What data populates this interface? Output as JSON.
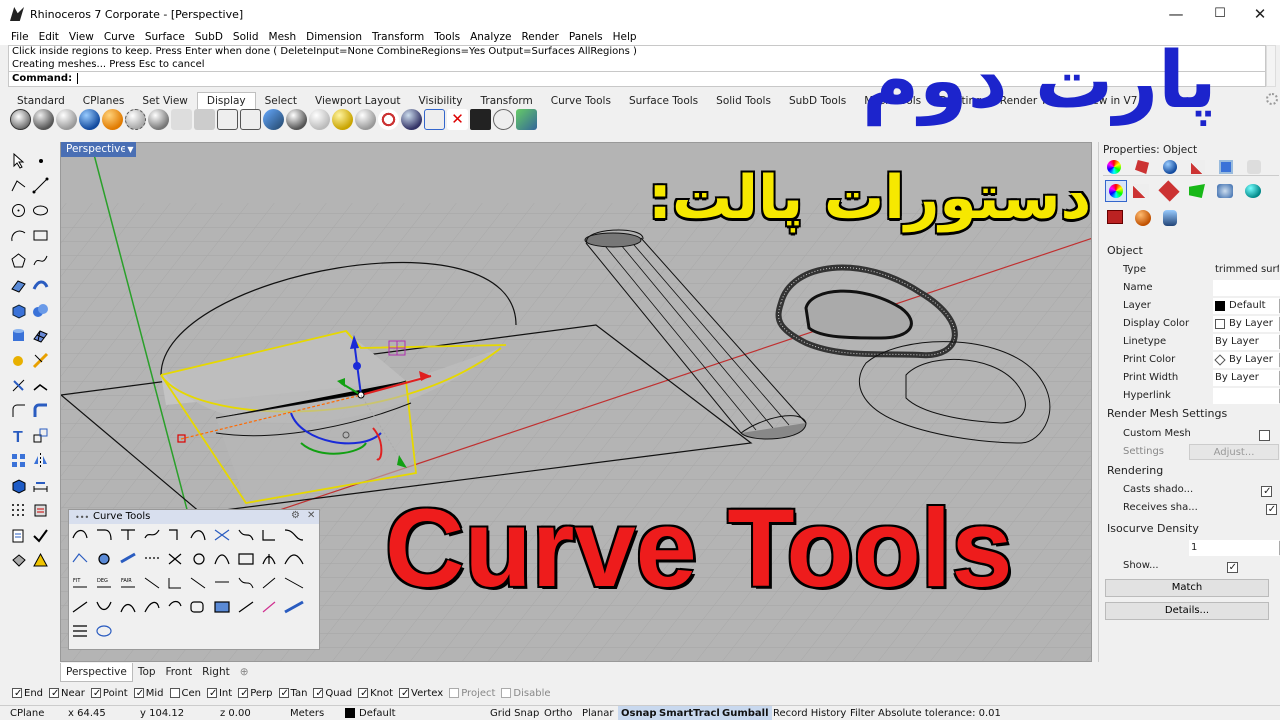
{
  "window": {
    "title": "Rhinoceros 7 Corporate - [Perspective]"
  },
  "menu": [
    "File",
    "Edit",
    "View",
    "Curve",
    "Surface",
    "SubD",
    "Solid",
    "Mesh",
    "Dimension",
    "Transform",
    "Tools",
    "Analyze",
    "Render",
    "Panels",
    "Help"
  ],
  "command": {
    "history": [
      "Click inside regions to keep. Press Enter when done ( DeleteInput=None  CombineRegions=Yes  Output=Surfaces  AllRegions )",
      "Creating meshes... Press Esc to cancel"
    ],
    "prompt_label": "Command:",
    "value": ""
  },
  "tabs": [
    "Standard",
    "CPlanes",
    "Set View",
    "Display",
    "Select",
    "Viewport Layout",
    "Visibility",
    "Transform",
    "Curve Tools",
    "Surface Tools",
    "Solid Tools",
    "SubD Tools",
    "Mesh Tools",
    "Drafting",
    "Render Tools",
    "New in V7"
  ],
  "active_tab": "Display",
  "viewport": {
    "label": "Perspective"
  },
  "overlay": {
    "title_fa": "پارت دوم",
    "subtitle_fa": "دستورات پالت:",
    "banner_en": "Curve Tools"
  },
  "curve_tools_panel": {
    "title": "Curve Tools"
  },
  "properties": {
    "header": "Properties: Object",
    "section_object": "Object",
    "rows": [
      {
        "label": "Type",
        "value": "trimmed surface"
      },
      {
        "label": "Name",
        "value": ""
      },
      {
        "label": "Layer",
        "value": "Default"
      },
      {
        "label": "Display Color",
        "value": "By Layer"
      },
      {
        "label": "Linetype",
        "value": "By Layer"
      },
      {
        "label": "Print Color",
        "value": "By Layer"
      },
      {
        "label": "Print Width",
        "value": "By Layer"
      },
      {
        "label": "Hyperlink",
        "value": ""
      }
    ],
    "hyperlink_button": "...",
    "section_render_mesh": "Render Mesh Settings",
    "custom_mesh_label": "Custom Mesh",
    "settings_label": "Settings",
    "adjust_button": "Adjust...",
    "section_rendering": "Rendering",
    "casts_shadows_label": "Casts shado...",
    "receives_shadows_label": "Receives sha...",
    "section_density": "Isocurve Density",
    "density_value": "1",
    "show_label": "Show...",
    "match_button": "Match",
    "details_button": "Details..."
  },
  "viewport_tabs": [
    "Perspective",
    "Top",
    "Front",
    "Right"
  ],
  "osnaps": [
    {
      "label": "End",
      "checked": true,
      "disabled": false
    },
    {
      "label": "Near",
      "checked": true,
      "disabled": false
    },
    {
      "label": "Point",
      "checked": true,
      "disabled": false
    },
    {
      "label": "Mid",
      "checked": true,
      "disabled": false
    },
    {
      "label": "Cen",
      "checked": false,
      "disabled": false
    },
    {
      "label": "Int",
      "checked": true,
      "disabled": false
    },
    {
      "label": "Perp",
      "checked": true,
      "disabled": false
    },
    {
      "label": "Tan",
      "checked": true,
      "disabled": false
    },
    {
      "label": "Quad",
      "checked": true,
      "disabled": false
    },
    {
      "label": "Knot",
      "checked": true,
      "disabled": false
    },
    {
      "label": "Vertex",
      "checked": true,
      "disabled": false
    },
    {
      "label": "Project",
      "checked": false,
      "disabled": true
    },
    {
      "label": "Disable",
      "checked": false,
      "disabled": true
    }
  ],
  "status": {
    "cplane": "CPlane",
    "x": "x 64.45",
    "y": "y 104.12",
    "z": "z 0.00",
    "units": "Meters",
    "layer": "Default",
    "grid_snap": "Grid Snap",
    "ortho": "Ortho",
    "planar": "Planar",
    "osnap": "Osnap",
    "smarttrack": "SmartTrack",
    "gumball": "Gumball",
    "record_history": "Record History",
    "filter": "Filter",
    "tolerance": "Absolute tolerance: 0.01"
  },
  "colors": {
    "viewport_bg": "#b4b4b4",
    "grid": "#a3a3a3",
    "selection": "#e6d800",
    "accent_blue": "#4a6fb4",
    "overlay_red": "#ee1c1c",
    "overlay_blue": "#1c24cc",
    "overlay_yellow": "#f6e800"
  }
}
